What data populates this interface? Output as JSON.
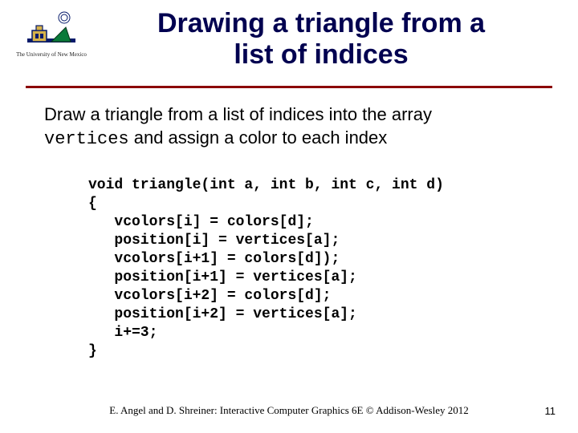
{
  "logo": {
    "caption": "The University of New Mexico"
  },
  "title": {
    "line1": "Drawing a triangle from a",
    "line2": "list of indices"
  },
  "desc": {
    "part1": "Draw a triangle from a list of indices into the array",
    "mono": "vertices",
    "part2": " and assign a color to each index"
  },
  "code": "void triangle(int a, int b, int c, int d)\n{\n   vcolors[i] = colors[d];\n   position[i] = vertices[a];\n   vcolors[i+1] = colors[d]);\n   position[i+1] = vertices[a];\n   vcolors[i+2] = colors[d];\n   position[i+2] = vertices[a];\n   i+=3;\n}",
  "footer": {
    "text": "E. Angel and D. Shreiner: Interactive Computer Graphics 6E © Addison-Wesley 2012",
    "page": "11"
  }
}
